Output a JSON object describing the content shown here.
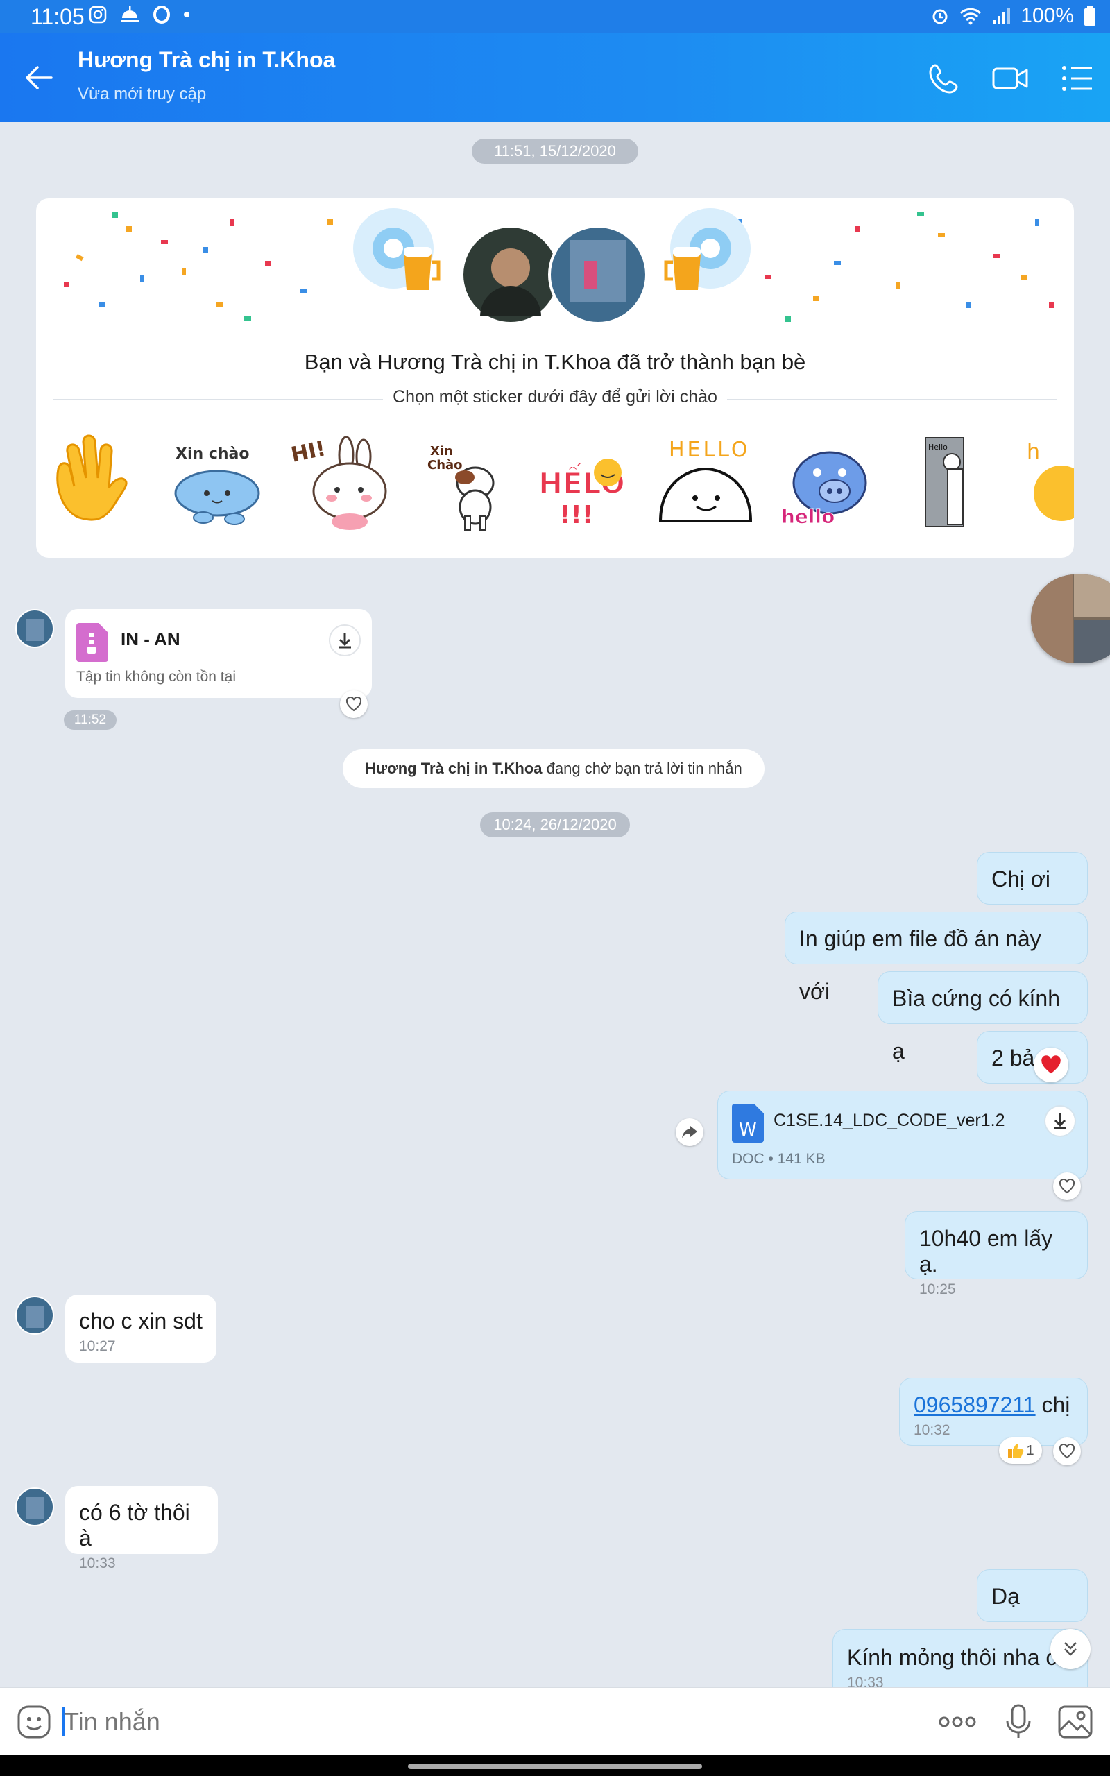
{
  "status_bar": {
    "time": "11:05",
    "battery": "100%"
  },
  "header": {
    "title": "Hương Trà chị in T.Khoa",
    "subtitle": "Vừa mới truy cập"
  },
  "date_pills": [
    "11:51, 15/12/2020",
    "10:24, 26/12/2020"
  ],
  "friend_card": {
    "text": "Bạn và Hương Trà chị in T.Khoa đã trở thành bạn bè",
    "hint": "Chọn một sticker dưới đây để gửi lời chào",
    "stickers": [
      "wave-hand",
      "Xin chào",
      "HI!",
      "Xin Chào",
      "HẾLÔ!!!",
      "HELLO",
      "hello",
      "Hello",
      "h"
    ]
  },
  "file_in": {
    "name": "IN - AN",
    "status": "Tập tin không còn tồn tại",
    "time": "11:52"
  },
  "waiting_notice": {
    "name": "Hương Trà chị in T.Khoa",
    "text": " đang chờ bạn trả lời tin nhắn"
  },
  "messages_out": [
    "Chị ơi",
    "In giúp em file đồ án này với",
    "Bìa cứng có kính ạ",
    "2 bả"
  ],
  "file_out": {
    "name": "C1SE.14_LDC_CODE_ver1.2",
    "meta": "DOC • 141 KB",
    "icon_letter": "W"
  },
  "msg_1040": {
    "text": "10h40 em lấy ạ.",
    "time": "10:25"
  },
  "msg_sdt": {
    "text": "cho c xin sdt",
    "time": "10:27"
  },
  "msg_phone": {
    "number": "0965897211",
    "suffix": " chị",
    "time": "10:32",
    "like_count": "1"
  },
  "msg_6to": {
    "text": "có 6 tờ thôi à",
    "time": "10:33"
  },
  "msg_da": {
    "text": "Dạ"
  },
  "msg_kinh": {
    "text": "Kính mỏng thôi nha c",
    "time": "10:33"
  },
  "input": {
    "placeholder": "Tin nhắn"
  },
  "colors": {
    "header": "#1a77f0",
    "out_bubble": "#d4ecfb",
    "background": "#e3e8ef",
    "link": "#1a73d9"
  }
}
